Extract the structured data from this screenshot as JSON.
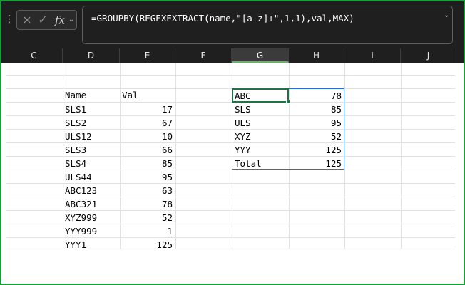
{
  "formula_bar": {
    "grip_icon": "vertical-dots",
    "cancel_icon": "×",
    "enter_icon": "✓",
    "fx_label": "fx",
    "dropdown_icon": "⌄",
    "formula": "=GROUPBY(REGEXEXTRACT(name,\"[a-z]+\",1,1),val,MAX)",
    "expand_icon": "⌄"
  },
  "columns": [
    "C",
    "D",
    "E",
    "F",
    "G",
    "H",
    "I",
    "J"
  ],
  "selected_column": "G",
  "source_table": {
    "headers": {
      "name": "Name",
      "val": "Val"
    },
    "rows": [
      {
        "name": "SLS1",
        "val": "17"
      },
      {
        "name": "SLS2",
        "val": "67"
      },
      {
        "name": "ULS12",
        "val": "10"
      },
      {
        "name": "SLS3",
        "val": "66"
      },
      {
        "name": "SLS4",
        "val": "85"
      },
      {
        "name": "ULS44",
        "val": "95"
      },
      {
        "name": "ABC123",
        "val": "63"
      },
      {
        "name": "ABC321",
        "val": "78"
      },
      {
        "name": "XYZ999",
        "val": "52"
      },
      {
        "name": "YYY999",
        "val": "1"
      },
      {
        "name": "YYY1",
        "val": "125"
      }
    ]
  },
  "result_table": {
    "rows": [
      {
        "key": "ABC",
        "value": "78"
      },
      {
        "key": "SLS",
        "value": "85"
      },
      {
        "key": "ULS",
        "value": "95"
      },
      {
        "key": "XYZ",
        "value": "52"
      },
      {
        "key": "YYY",
        "value": "125"
      },
      {
        "key": "Total",
        "value": "125"
      }
    ]
  },
  "colors": {
    "frame": "#1f9a3a",
    "header_bg": "#1f1f1f",
    "active_cell_border": "#217346",
    "spill_border": "#2a6fc9"
  }
}
